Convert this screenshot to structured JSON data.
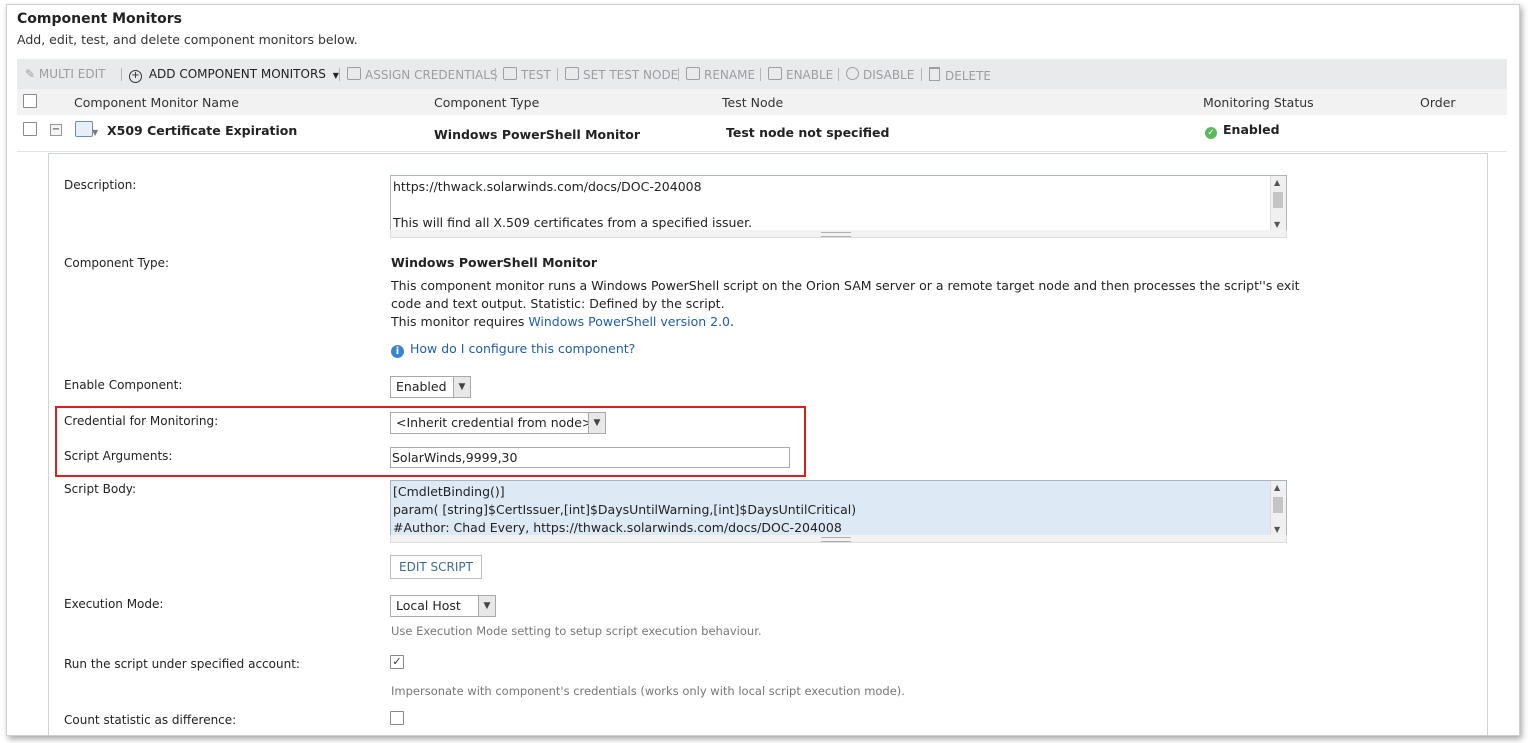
{
  "header": {
    "title": "Component Monitors",
    "subtitle": "Add, edit, test, and delete component monitors below."
  },
  "toolbar": {
    "multi_edit": "MULTI EDIT",
    "add_component_monitors": "ADD COMPONENT MONITORS",
    "assign_credentials": "ASSIGN CREDENTIALS",
    "test": "TEST",
    "set_test_node": "SET TEST NODE",
    "rename": "RENAME",
    "enable": "ENABLE",
    "disable": "DISABLE",
    "delete": "DELETE"
  },
  "columns": {
    "name": "Component Monitor Name",
    "type": "Component Type",
    "test_node": "Test Node",
    "status": "Monitoring Status",
    "order": "Order"
  },
  "row": {
    "name": "X509 Certificate Expiration",
    "type": "Windows PowerShell Monitor",
    "test_node": "Test node not specified",
    "status": "Enabled"
  },
  "details": {
    "description_label": "Description:",
    "description_value": "https://thwack.solarwinds.com/docs/DOC-204008\n\nThis will find all X.509 certificates from a specified issuer.",
    "component_type_label": "Component Type:",
    "component_type_name": "Windows PowerShell Monitor",
    "component_type_desc1": "This component monitor runs a Windows PowerShell script on the Orion SAM server or a remote target node and then processes the script''s exit",
    "component_type_desc2": "code and text output. Statistic: Defined by the script.",
    "component_type_desc3_prefix": "This monitor requires ",
    "component_type_desc3_link": "Windows PowerShell version 2.0",
    "component_type_desc3_suffix": ".",
    "how_configure": "How do I configure this component?",
    "enable_label": "Enable Component:",
    "enable_value": "Enabled",
    "credential_label": "Credential for Monitoring:",
    "credential_value": "<Inherit credential from node>",
    "script_args_label": "Script Arguments:",
    "script_args_value": "SolarWinds,9999,30",
    "script_body_label": "Script Body:",
    "script_body_value": "[CmdletBinding()]\nparam( [string]$CertIssuer,[int]$DaysUntilWarning,[int]$DaysUntilCritical)\n#Author: Chad Every, https://thwack.solarwinds.com/docs/DOC-204008",
    "edit_script": "EDIT SCRIPT",
    "execution_mode_label": "Execution Mode:",
    "execution_mode_value": "Local Host",
    "execution_mode_hint": "Use Execution Mode setting to setup script execution behaviour.",
    "run_as_label": "Run the script under specified account:",
    "run_as_checked": true,
    "run_as_hint": "Impersonate with component's credentials (works only with local script execution mode).",
    "count_diff_label": "Count statistic as difference:",
    "count_diff_checked": false
  },
  "colors": {
    "highlight_border": "#d9201f",
    "link": "#1f5fa8",
    "status_ok": "#5cb85c"
  }
}
